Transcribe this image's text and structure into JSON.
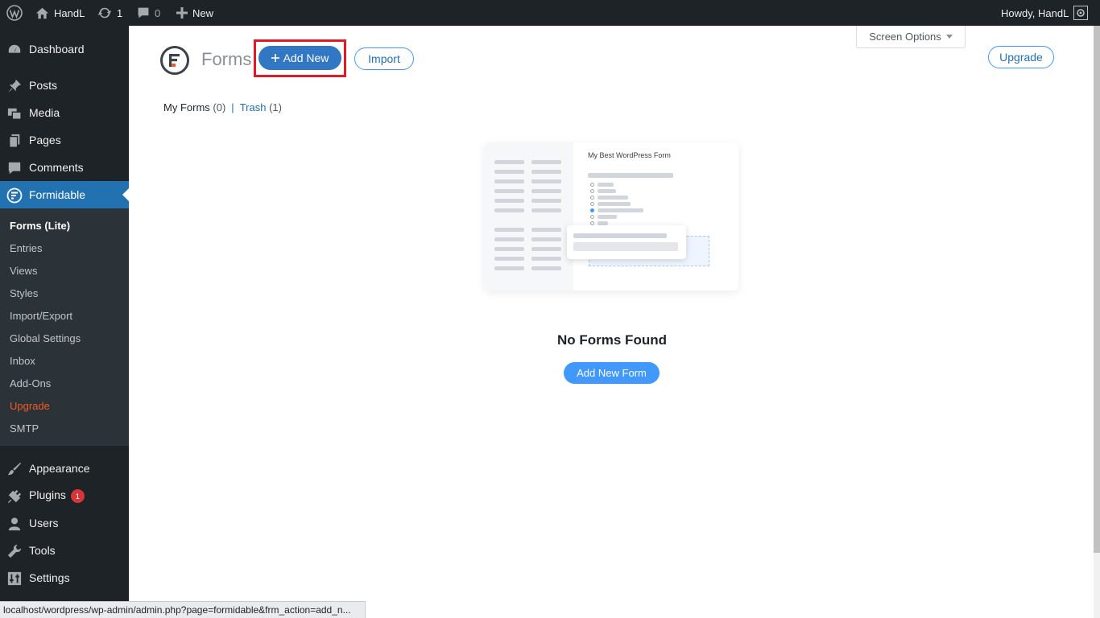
{
  "adminbar": {
    "site_name": "HandL",
    "updates_count": "1",
    "comments_count": "0",
    "new_label": "New",
    "howdy": "Howdy, HandL"
  },
  "sidebar": {
    "items_top": [
      {
        "label": "Dashboard",
        "icon": "dashboard-icon"
      },
      {
        "label": "Posts",
        "icon": "pin-icon"
      },
      {
        "label": "Media",
        "icon": "media-icon"
      },
      {
        "label": "Pages",
        "icon": "pages-icon"
      },
      {
        "label": "Comments",
        "icon": "comment-icon"
      },
      {
        "label": "Formidable",
        "icon": "formidable-icon"
      }
    ],
    "submenu": [
      "Forms (Lite)",
      "Entries",
      "Views",
      "Styles",
      "Import/Export",
      "Global Settings",
      "Inbox",
      "Add-Ons",
      "Upgrade",
      "SMTP"
    ],
    "items_bottom": [
      {
        "label": "Appearance",
        "icon": "brush-icon"
      },
      {
        "label": "Plugins",
        "icon": "plugin-icon",
        "badge": "1"
      },
      {
        "label": "Users",
        "icon": "user-icon"
      },
      {
        "label": "Tools",
        "icon": "wrench-icon"
      },
      {
        "label": "Settings",
        "icon": "settings-icon"
      }
    ]
  },
  "header": {
    "screen_options": "Screen Options",
    "title": "Forms",
    "add_new": "Add New",
    "import": "Import",
    "upgrade": "Upgrade"
  },
  "views": {
    "my_forms": "My Forms",
    "my_forms_count": "(0)",
    "separator": "|",
    "trash": "Trash",
    "trash_count": "(1)"
  },
  "empty": {
    "illustration_title": "My Best WordPress Form",
    "message": "No Forms Found",
    "button": "Add New Form"
  },
  "status_bar": {
    "url": "localhost/wordpress/wp-admin/admin.php?page=formidable&frm_action=add_n..."
  },
  "colors": {
    "admin_bar": "#1d2327",
    "accent": "#2271b1",
    "highlight": "#e01b24",
    "button_blue": "#4199fd",
    "upgrade_orange": "#f05a24"
  }
}
